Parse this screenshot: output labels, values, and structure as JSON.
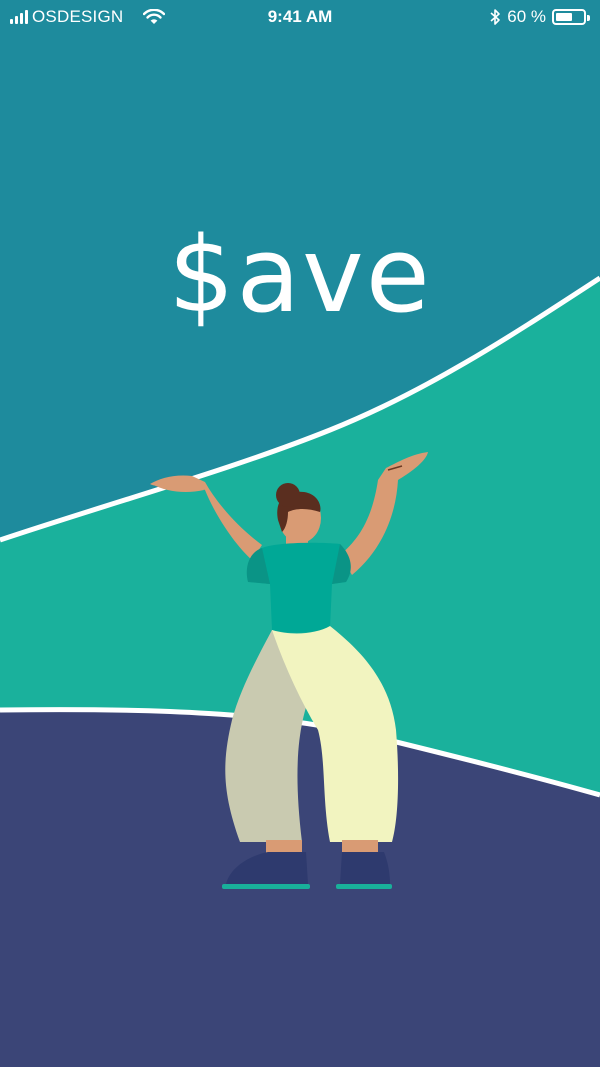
{
  "status_bar": {
    "carrier": "OSDESIGN",
    "time": "9:41 AM",
    "battery_text": "60 %",
    "battery_level": 0.6,
    "icons": [
      "signal-bars-icon",
      "wifi-icon",
      "bluetooth-icon",
      "battery-icon"
    ]
  },
  "hero": {
    "headline": "$ave"
  },
  "colors": {
    "sky": "#1e8b9d",
    "hill": "#1ab19c",
    "ground": "#3b4577",
    "line": "#ffffff",
    "skin": "#d99b74",
    "shirt": "#00a896",
    "pants_light": "#f2f4c0",
    "pants_dark": "#c9cab0",
    "shoes": "#2e3a6e",
    "hair": "#5a2e1f"
  }
}
